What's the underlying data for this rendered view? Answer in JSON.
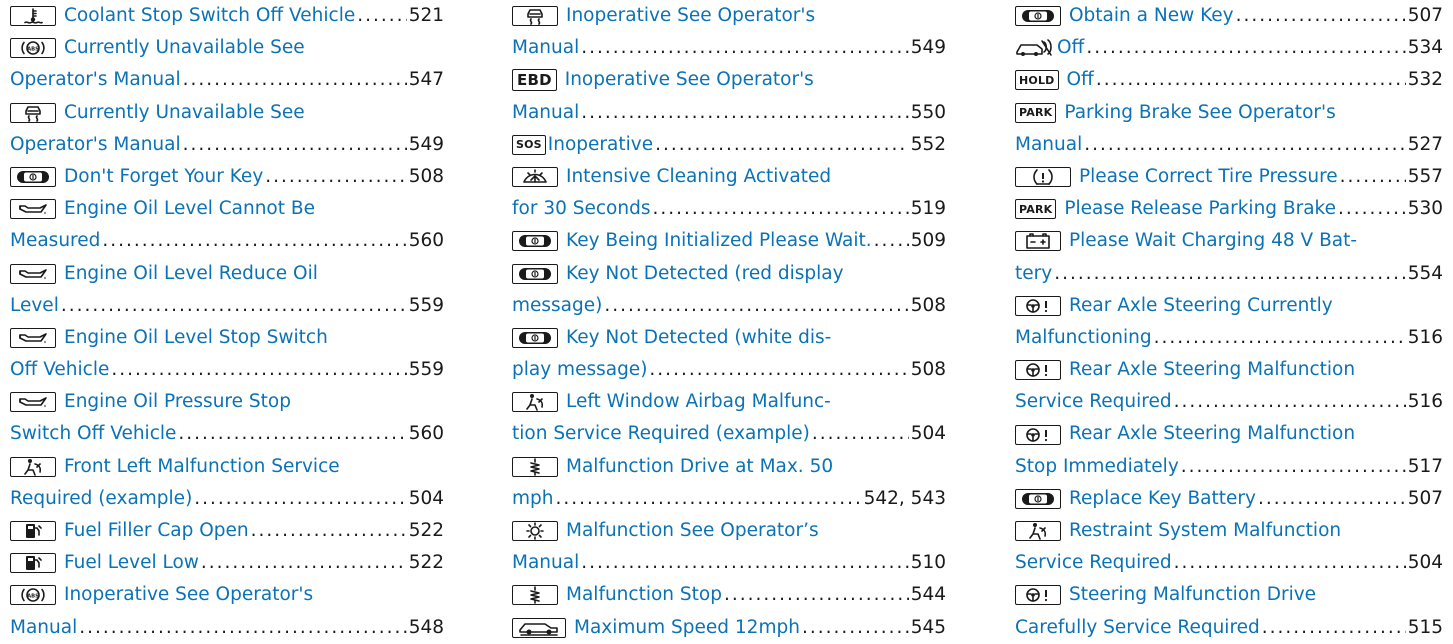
{
  "index": {
    "columns": [
      {
        "entries": [
          {
            "icon": "coolant-temperature-icon",
            "lines": [
              "Coolant Stop Switch Off Vehicle"
            ],
            "page": "521"
          },
          {
            "icon": "abs-icon",
            "lines": [
              "Currently Unavailable See",
              "Operator's Manual"
            ],
            "page": "547"
          },
          {
            "icon": "skid-car-icon",
            "lines": [
              "Currently Unavailable See",
              "Operator's Manual"
            ],
            "page": "549"
          },
          {
            "icon": "key-icon",
            "lines": [
              "Don't Forget Your Key"
            ],
            "page": "508"
          },
          {
            "icon": "oil-can-icon",
            "lines": [
              "Engine Oil Level Cannot Be",
              "Measured"
            ],
            "page": "560"
          },
          {
            "icon": "oil-can-icon",
            "lines": [
              "Engine Oil Level Reduce Oil",
              "Level"
            ],
            "page": "559"
          },
          {
            "icon": "oil-can-icon",
            "lines": [
              "Engine Oil Level Stop Switch",
              "Off Vehicle"
            ],
            "page": "559"
          },
          {
            "icon": "oil-can-icon",
            "lines": [
              "Engine Oil Pressure Stop",
              "Switch Off Vehicle"
            ],
            "page": "560"
          },
          {
            "icon": "airbag-icon",
            "lines": [
              "Front Left Malfunction Service",
              "Required (example)"
            ],
            "page": "504"
          },
          {
            "icon": "fuel-pump-icon",
            "lines": [
              "Fuel Filler Cap Open"
            ],
            "page": "522"
          },
          {
            "icon": "fuel-pump-icon",
            "lines": [
              "Fuel Level Low"
            ],
            "page": "522"
          },
          {
            "icon": "abs-icon",
            "lines": [
              "Inoperative See Operator's",
              "Manual"
            ],
            "page": "548"
          }
        ]
      },
      {
        "entries": [
          {
            "icon": "skid-car-icon",
            "lines": [
              "Inoperative See Operator's",
              "Manual"
            ],
            "page": "549"
          },
          {
            "icon": "ebd-icon",
            "icon_text": "EBD",
            "lines": [
              "Inoperative See Operator's",
              "Manual"
            ],
            "page": "550"
          },
          {
            "icon": "sos-phone-icon",
            "icon_text": "SOS",
            "lines": [
              "Inoperative"
            ],
            "page": "552"
          },
          {
            "icon": "windshield-washer-icon",
            "lines": [
              "Intensive Cleaning Activated",
              "for 30 Seconds"
            ],
            "page": "519"
          },
          {
            "icon": "key-icon",
            "lines": [
              "Key Being Initialized Please Wait."
            ],
            "page": "509"
          },
          {
            "icon": "key-icon",
            "lines": [
              "Key Not Detected (red display",
              "message)"
            ],
            "page": "508"
          },
          {
            "icon": "key-icon",
            "lines": [
              "Key Not Detected (white dis-",
              "play message)"
            ],
            "page": "508"
          },
          {
            "icon": "airbag-icon",
            "lines": [
              "Left Window Airbag Malfunc-",
              "tion Service Required (example)"
            ],
            "page": "504"
          },
          {
            "icon": "suspension-icon",
            "lines": [
              "Malfunction Drive at Max. 50",
              "mph"
            ],
            "page": "542, 543"
          },
          {
            "icon": "light-icon",
            "lines": [
              "Malfunction See Operator’s",
              "Manual"
            ],
            "page": "510"
          },
          {
            "icon": "suspension-icon",
            "lines": [
              "Malfunction Stop"
            ],
            "page": "544"
          },
          {
            "icon": "car-level-icon",
            "lines": [
              "Maximum Speed 12mph"
            ],
            "page": "545"
          }
        ]
      },
      {
        "entries": [
          {
            "icon": "key-icon",
            "lines": [
              "Obtain a New Key"
            ],
            "page": "507"
          },
          {
            "icon": "car-sensor-off-icon",
            "lines": [
              "Off"
            ],
            "page": "534"
          },
          {
            "icon": "hold-icon",
            "icon_text": "HOLD",
            "lines": [
              "Off"
            ],
            "page": "532"
          },
          {
            "icon": "park-icon",
            "icon_text": "PARK",
            "lines": [
              "Parking Brake See Operator's",
              "Manual"
            ],
            "page": "527"
          },
          {
            "icon": "tire-pressure-icon",
            "lines": [
              "Please Correct Tire Pressure"
            ],
            "page": "557"
          },
          {
            "icon": "park-icon",
            "icon_text": "PARK",
            "lines": [
              "Please Release Parking Brake"
            ],
            "page": "530"
          },
          {
            "icon": "battery-icon",
            "lines": [
              "Please Wait Charging 48 V Bat-",
              "tery"
            ],
            "page": "554"
          },
          {
            "icon": "steering-warning-icon",
            "lines": [
              "Rear Axle Steering Currently",
              "Malfunctioning"
            ],
            "page": "516"
          },
          {
            "icon": "steering-warning-icon",
            "lines": [
              "Rear Axle Steering Malfunction",
              "Service Required"
            ],
            "page": "516"
          },
          {
            "icon": "steering-warning-icon",
            "lines": [
              "Rear Axle Steering Malfunction",
              "Stop Immediately"
            ],
            "page": "517"
          },
          {
            "icon": "key-icon",
            "lines": [
              "Replace Key Battery"
            ],
            "page": "507"
          },
          {
            "icon": "airbag-icon",
            "lines": [
              "Restraint System Malfunction",
              "Service Required"
            ],
            "page": "504"
          },
          {
            "icon": "steering-warning-icon",
            "lines": [
              "Steering Malfunction Drive",
              "Carefully Service Required"
            ],
            "page": "515"
          }
        ]
      }
    ]
  }
}
